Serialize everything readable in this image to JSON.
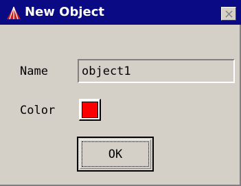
{
  "window": {
    "title": "New Object",
    "title_bar_color": "#0a0a84",
    "app_icon": "triangle-logo-icon",
    "close_icon": "close-icon"
  },
  "form": {
    "name_label": "Name",
    "name_value": "object1",
    "color_label": "Color",
    "color_value": "#ff0000"
  },
  "actions": {
    "ok_label": "OK"
  }
}
